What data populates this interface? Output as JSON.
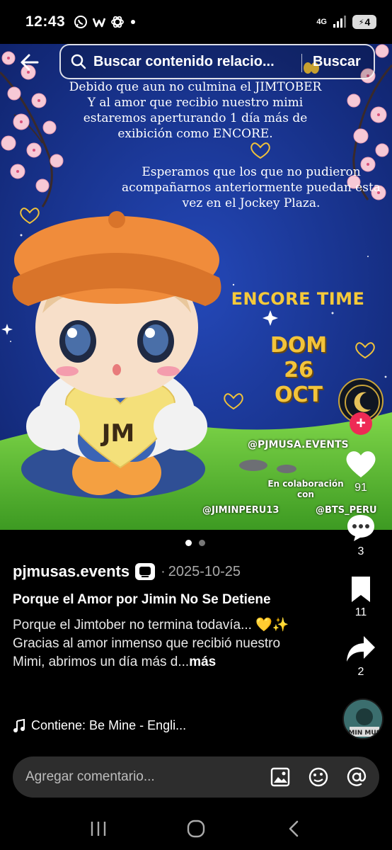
{
  "status_bar": {
    "time": "12:43",
    "left_icons": [
      "whatsapp-icon",
      "w-app-icon",
      "chatgpt-icon",
      "dot-icon"
    ],
    "network": "4G",
    "battery": "4"
  },
  "search": {
    "query": "Buscar contenido relacio...",
    "submit_label": "Buscar"
  },
  "poster": {
    "paragraph_1": "Debido que aun no culmina el JIMTOBER Y  al amor que recibio nuestro mimi estaremos aperturando 1 día más de exibición como ENCORE.",
    "paragraph_2": "Esperamos que los que no pudieron acompañarnos anteriormente  puedan esta vez en el Jockey Plaza.",
    "encore_title": "ENCORE TIME",
    "date_day": "DOM",
    "date_num": "26",
    "date_month": "OCT",
    "character_badge": "JM",
    "main_handle": "@PJMUSA.EVENTS",
    "collab_line1": "En colaboración",
    "collab_line2": "con",
    "handle_left": "@JIMINPERU13",
    "handle_right": "@BTS_PERU"
  },
  "actions": {
    "likes": "91",
    "comments": "3",
    "saves": "11",
    "shares": "2"
  },
  "post": {
    "author": "pjmusas.events",
    "separator": "·",
    "date": "2025-10-25",
    "title": "Porque el Amor por Jimin No Se Detiene",
    "body_line1": "Porque el Jimtober no termina todavía... 💛✨",
    "body_line2": "Gracias al amor inmenso que recibió nuestro Mimi, abrimos un día más d...",
    "more_label": "más",
    "sound": "Contiene: Be Mine - Engli..."
  },
  "comment": {
    "placeholder": "Agregar comentario..."
  },
  "music_disc_label": "JIMIN MUSE",
  "colors": {
    "poster_sky": "#1e3a9a",
    "accent_gold": "#f3c43b",
    "follow_red": "#ee2a55"
  }
}
